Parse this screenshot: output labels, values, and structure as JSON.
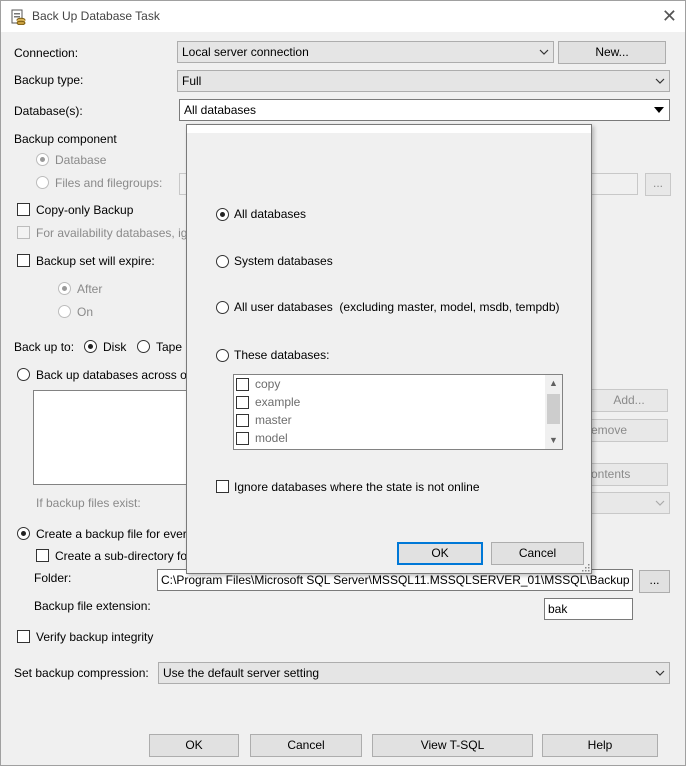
{
  "window": {
    "title": "Back Up Database Task",
    "close": "✕"
  },
  "form": {
    "connection_label": "Connection:",
    "connection_value": "Local server connection",
    "new_button": "New...",
    "backup_type_label": "Backup type:",
    "backup_type_value": "Full",
    "databases_label": "Database(s):",
    "databases_value": "All databases",
    "backup_component_label": "Backup component",
    "component_database": "Database",
    "component_files": "Files and filegroups:",
    "browse_button": "...",
    "copy_only": "Copy-only Backup",
    "availability": "For availability databases, ig",
    "expire": "Backup set will expire:",
    "after": "After",
    "on": "On",
    "backup_to_label": "Back up to:",
    "disk": "Disk",
    "tape": "Tape",
    "across": "Back up databases across on",
    "add_button": "Add...",
    "remove_button": "emove",
    "contents_button": "ontents",
    "if_exist": "If backup files exist:",
    "create_file": "Create a backup file for every",
    "sub_directory": "Create a sub-directory fo",
    "folder_label": "Folder:",
    "folder_value": "C:\\Program Files\\Microsoft SQL Server\\MSSQL11.MSSQLSERVER_01\\MSSQL\\Backup",
    "folder_browse": "...",
    "ext_label": "Backup file extension:",
    "ext_value": "bak",
    "verify": "Verify backup integrity",
    "compression_label": "Set backup compression:",
    "compression_value": "Use the default server setting"
  },
  "footer": {
    "ok": "OK",
    "cancel": "Cancel",
    "view_tsql": "View T-SQL",
    "help": "Help"
  },
  "popup": {
    "all_databases": "All databases",
    "system_databases": "System databases",
    "all_user_databases": "All user databases  (excluding master, model, msdb, tempdb)",
    "these_databases": "These databases:",
    "databases": [
      "copy",
      "example",
      "master",
      "model"
    ],
    "ignore_offline": "Ignore databases where the state is not online",
    "ok": "OK",
    "cancel": "Cancel",
    "selected_option": "All databases"
  }
}
